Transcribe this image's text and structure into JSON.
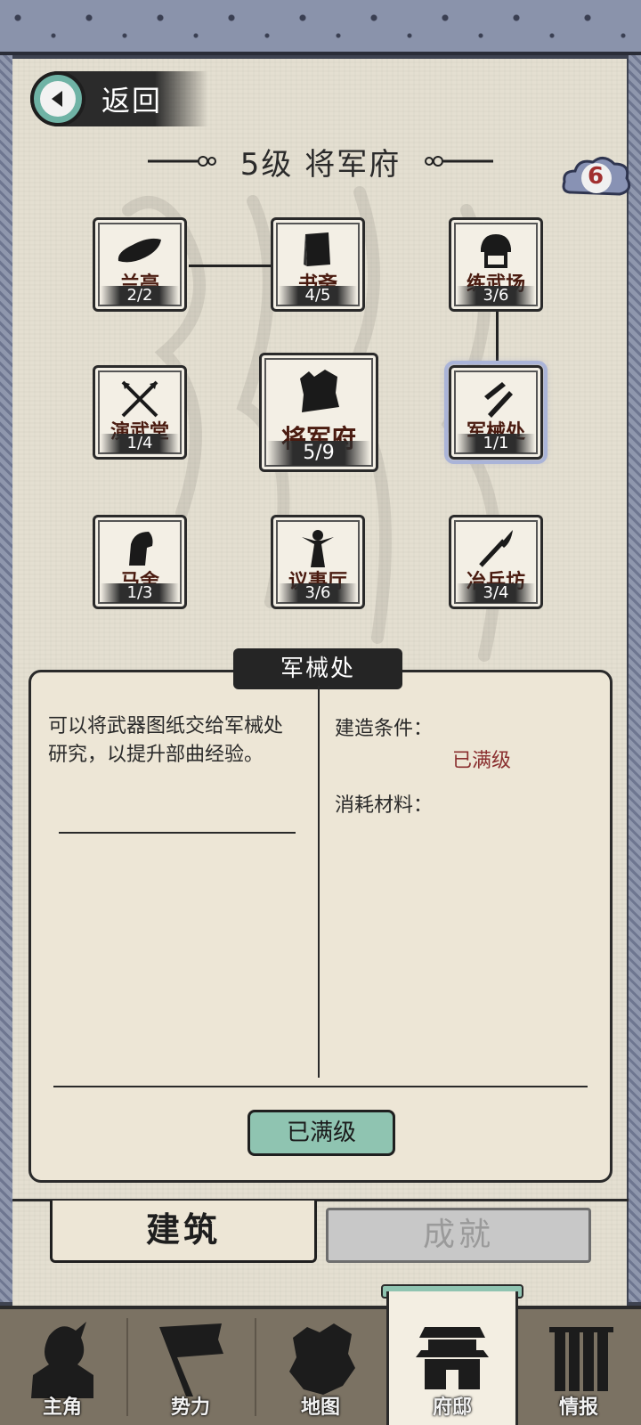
{
  "header": {
    "back_label": "返回"
  },
  "page": {
    "title": "5级 将军府",
    "badge_count": "6"
  },
  "buildings": [
    {
      "name": "兰亭",
      "progress": "2/2"
    },
    {
      "name": "书斋",
      "progress": "4/5"
    },
    {
      "name": "练武场",
      "progress": "3/6"
    },
    {
      "name": "演武堂",
      "progress": "1/4"
    },
    {
      "name": "将军府",
      "progress": "5/9"
    },
    {
      "name": "军械处",
      "progress": "1/1"
    },
    {
      "name": "马舍",
      "progress": "1/3"
    },
    {
      "name": "议事厅",
      "progress": "3/6"
    },
    {
      "name": "冶兵坊",
      "progress": "3/4"
    }
  ],
  "selected_building": "军械处",
  "detail": {
    "title": "军械处",
    "description": "可以将武器图纸交给军械处研究，以提升部曲经验。",
    "build_condition_label": "建造条件：",
    "build_condition_value": "已满级",
    "materials_label": "消耗材料：",
    "action_label": "已满级"
  },
  "tabs": {
    "build": "建筑",
    "achievements": "成就"
  },
  "nav": [
    {
      "label": "主角",
      "icon": "hero-icon"
    },
    {
      "label": "势力",
      "icon": "flag-icon"
    },
    {
      "label": "地图",
      "icon": "map-icon"
    },
    {
      "label": "府邸",
      "icon": "mansion-icon",
      "active": true
    },
    {
      "label": "情报",
      "icon": "scroll-icon"
    }
  ],
  "colors": {
    "accent": "#8fc4b1",
    "text_dark": "#2a2a2a",
    "maxed_red": "#8a2f2f",
    "parchment": "#e4dfd1"
  }
}
